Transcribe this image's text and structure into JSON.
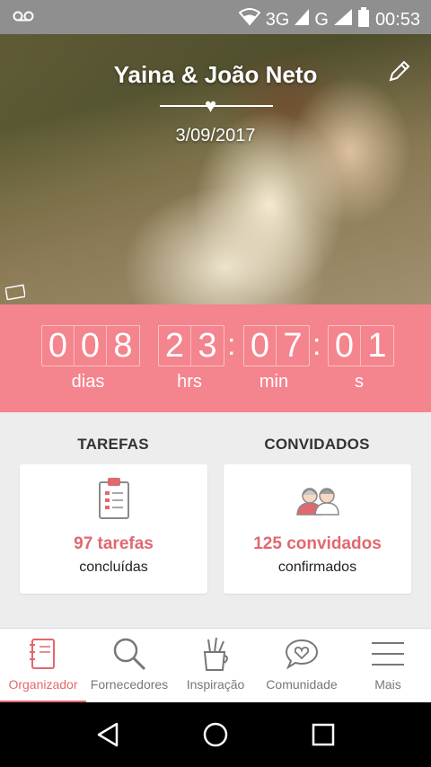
{
  "status_bar": {
    "network": "3G",
    "carrier_signal": "G",
    "time": "00:53",
    "icons": [
      "voicemail-icon",
      "wifi-icon",
      "signal-icon",
      "battery-icon"
    ]
  },
  "hero": {
    "couple_name": "Yaina & João Neto",
    "date": "3/09/2017",
    "icons": [
      "heart-icon",
      "edit-icon"
    ]
  },
  "countdown": {
    "days": [
      "0",
      "0",
      "8"
    ],
    "hours": [
      "2",
      "3"
    ],
    "minutes": [
      "0",
      "7"
    ],
    "seconds": [
      "0",
      "1"
    ],
    "separator": ":",
    "labels": {
      "days": "dias",
      "hours": "hrs",
      "minutes": "min",
      "seconds": "s"
    }
  },
  "tasks": {
    "title": "TAREFAS",
    "count": "97 tarefas",
    "sub": "concluídas",
    "icon": "clipboard-icon"
  },
  "guests": {
    "title": "CONVIDADOS",
    "count": "125 convidados",
    "sub": "confirmados",
    "icon": "guests-icon"
  },
  "bottom_nav": {
    "items": [
      {
        "label": "Organizador",
        "icon": "notebook-icon",
        "active": true
      },
      {
        "label": "Fornecedores",
        "icon": "search-icon",
        "active": false
      },
      {
        "label": "Inspiração",
        "icon": "pencil-cup-icon",
        "active": false
      },
      {
        "label": "Comunidade",
        "icon": "chat-heart-icon",
        "active": false
      },
      {
        "label": "Mais",
        "icon": "menu-icon",
        "active": false
      }
    ]
  },
  "colors": {
    "accent": "#e0686f",
    "countdown_bg": "#f4848d",
    "nav_inactive": "#777777"
  }
}
